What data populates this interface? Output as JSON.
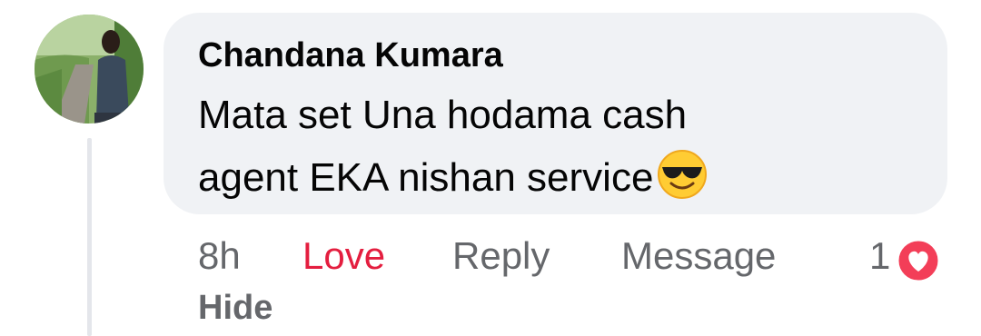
{
  "comment": {
    "author": "Chandana Kumara",
    "text_line1": "Mata set Una hodama cash",
    "text_line2": "agent EKA nishan service",
    "emoji": "smiling-face-with-sunglasses-icon",
    "avatar": "profile-photo"
  },
  "actions": {
    "time": "8h",
    "love": "Love",
    "reply": "Reply",
    "message": "Message",
    "reaction_count": "1",
    "hide": "Hide"
  },
  "colors": {
    "bubble": "#f0f2f5",
    "love_active": "#e41e3f",
    "meta_text": "#65676b",
    "body_text": "#050505"
  }
}
